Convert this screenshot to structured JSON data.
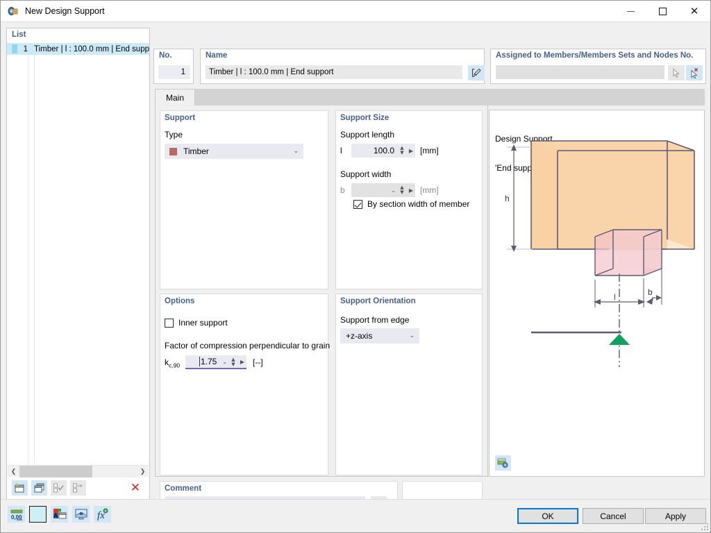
{
  "window": {
    "title": "New Design Support",
    "icon": "app-icon",
    "minimize": "–",
    "maximize": "□",
    "close": "✕"
  },
  "list_panel": {
    "header": "List",
    "rows": [
      {
        "num": "1",
        "label": "Timber | l : 100.0 mm | End supp"
      }
    ],
    "toolbar": [
      {
        "name": "new-item-button",
        "glyph": "new"
      },
      {
        "name": "copy-item-button",
        "glyph": "copy"
      },
      {
        "name": "select-all-button",
        "glyph": "check"
      },
      {
        "name": "deselect-button",
        "glyph": "uncheck"
      },
      {
        "name": "delete-item-button",
        "glyph": "✕"
      }
    ],
    "scroll_left": "❮",
    "scroll_right": "❯"
  },
  "no_box": {
    "caption": "No.",
    "value": "1"
  },
  "name_box": {
    "caption": "Name",
    "value": "Timber | l : 100.0 mm | End support",
    "edit_button": "edit-name-button"
  },
  "assign_box": {
    "caption": "Assigned to Members/Members Sets and Nodes No.",
    "value": "",
    "pick_button": "pick-objects-button",
    "clear_pick_button": "clear-pick-button"
  },
  "tabs": [
    {
      "label": "Main",
      "active": true
    }
  ],
  "support": {
    "caption": "Support",
    "type_label": "Type",
    "type_value": "Timber",
    "type_color": "#b96a61"
  },
  "support_size": {
    "caption": "Support Size",
    "length_label": "Support length",
    "length_symbol": "l",
    "length_value": "100.0",
    "length_unit": "[mm]",
    "width_label": "Support width",
    "width_symbol": "b",
    "width_value": "",
    "width_unit": "[mm]",
    "by_section_width_label": "By section width of member",
    "by_section_width_checked": true
  },
  "options": {
    "caption": "Options",
    "inner_support_label": "Inner support",
    "inner_support_checked": false,
    "factor_label": "Factor of compression perpendicular to grain",
    "factor_symbol_main": "k",
    "factor_symbol_sub": "c,90",
    "factor_value": "1.75",
    "factor_unit": "[--]"
  },
  "support_orientation": {
    "caption": "Support Orientation",
    "edge_label": "Support from edge",
    "edge_value": "+z-axis"
  },
  "comment": {
    "caption": "Comment",
    "value": "",
    "copy_button": "comment-templates-button"
  },
  "preview": {
    "line1": "Design Support",
    "line2": "'End support'",
    "title": "Design Support\n'End support'",
    "labels": {
      "h": "h",
      "l": "l",
      "b": "b"
    },
    "colors": {
      "beam_fill": "#f9d3a8",
      "beam_fill_dark": "#f4b36a",
      "support_fill": "#f7d5d8",
      "edge": "#5d5a72",
      "support_symbol": "#12a05e"
    },
    "settings_button": "preview-settings-button"
  },
  "bottom_toolbar": [
    {
      "name": "decimal-places-button",
      "glyph": "0,00"
    },
    {
      "name": "color-swatch-button",
      "glyph": "swatch"
    },
    {
      "name": "rename-button",
      "glyph": "rename"
    },
    {
      "name": "view-mode-button",
      "glyph": "view"
    },
    {
      "name": "formula-button",
      "glyph": "fx"
    }
  ],
  "dialog_buttons": {
    "ok": "OK",
    "cancel": "Cancel",
    "apply": "Apply"
  }
}
